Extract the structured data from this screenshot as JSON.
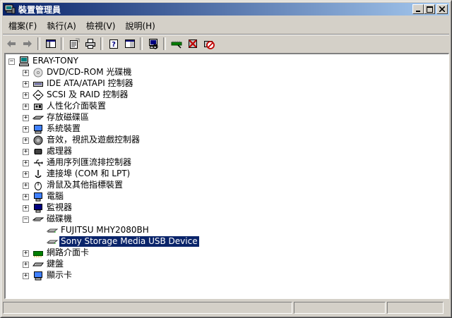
{
  "window": {
    "title": "裝置管理員",
    "title_icon": "device-manager-icon"
  },
  "menu": [
    {
      "label": "檔案(F)"
    },
    {
      "label": "執行(A)"
    },
    {
      "label": "檢視(V)"
    },
    {
      "label": "說明(H)"
    }
  ],
  "toolbar": [
    {
      "name": "back-button",
      "icon": "arrow-left-icon"
    },
    {
      "name": "forward-button",
      "icon": "arrow-right-icon"
    },
    {
      "sep": true
    },
    {
      "name": "show-hide-tree-button",
      "icon": "console-tree-icon"
    },
    {
      "sep": true
    },
    {
      "name": "properties-button",
      "icon": "properties-icon"
    },
    {
      "name": "print-button",
      "icon": "printer-icon"
    },
    {
      "sep": true
    },
    {
      "name": "help-button",
      "icon": "help-icon"
    },
    {
      "name": "view-button",
      "icon": "view-icon"
    },
    {
      "sep": true
    },
    {
      "name": "scan-hardware-button",
      "icon": "scan-hardware-icon"
    },
    {
      "sep": true
    },
    {
      "name": "update-driver-button",
      "icon": "update-driver-icon"
    },
    {
      "name": "uninstall-button",
      "icon": "uninstall-icon"
    },
    {
      "name": "disable-button",
      "icon": "disable-icon"
    }
  ],
  "tree": {
    "root": {
      "label": "ERAY-TONY",
      "icon": "computer-icon"
    },
    "categories": [
      {
        "label": "DVD/CD-ROM 光碟機",
        "icon": "cdrom-icon"
      },
      {
        "label": "IDE ATA/ATAPI 控制器",
        "icon": "ide-controller-icon"
      },
      {
        "label": "SCSI 及 RAID 控制器",
        "icon": "scsi-icon"
      },
      {
        "label": "人性化介面裝置",
        "icon": "hid-icon"
      },
      {
        "label": "存放磁碟區",
        "icon": "storage-volume-icon"
      },
      {
        "label": "系統裝置",
        "icon": "system-device-icon"
      },
      {
        "label": "音效，視訊及遊戲控制器",
        "icon": "sound-icon"
      },
      {
        "label": "處理器",
        "icon": "processor-icon"
      },
      {
        "label": "通用序列匯流排控制器",
        "icon": "usb-icon"
      },
      {
        "label": "連接埠 (COM 和 LPT)",
        "icon": "port-icon"
      },
      {
        "label": "滑鼠及其他指標裝置",
        "icon": "mouse-icon"
      },
      {
        "label": "電腦",
        "icon": "computer-small-icon"
      },
      {
        "label": "監視器",
        "icon": "monitor-icon"
      },
      {
        "label": "磁碟機",
        "icon": "disk-drive-icon",
        "expanded": true,
        "children": [
          {
            "label": "FUJITSU MHY2080BH",
            "icon": "hard-disk-icon"
          },
          {
            "label": "Sony Storage Media USB Device",
            "icon": "hard-disk-icon",
            "selected": true
          }
        ]
      },
      {
        "label": "網路介面卡",
        "icon": "network-adapter-icon"
      },
      {
        "label": "鍵盤",
        "icon": "keyboard-icon"
      },
      {
        "label": "顯示卡",
        "icon": "display-adapter-icon"
      }
    ]
  },
  "statusbar": {
    "panels": [
      "",
      "",
      ""
    ]
  }
}
